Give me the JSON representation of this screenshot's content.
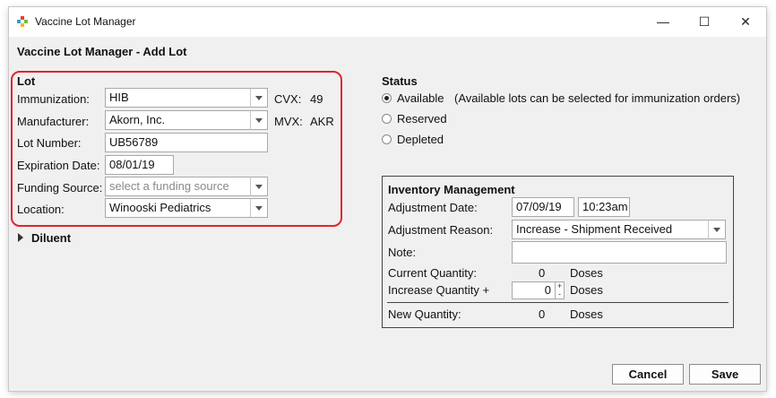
{
  "window": {
    "title": "Vaccine Lot Manager",
    "controls": {
      "minimize": "—",
      "maximize": "☐",
      "close": "✕"
    }
  },
  "page": {
    "heading": "Vaccine Lot Manager - Add Lot"
  },
  "lot": {
    "section_title": "Lot",
    "immunization": {
      "label": "Immunization:",
      "value": "HIB",
      "code_label": "CVX:",
      "code": "49"
    },
    "manufacturer": {
      "label": "Manufacturer:",
      "value": "Akorn, Inc.",
      "code_label": "MVX:",
      "code": "AKR"
    },
    "lot_number": {
      "label": "Lot Number:",
      "value": "UB56789"
    },
    "expiration": {
      "label": "Expiration Date:",
      "value": "08/01/19"
    },
    "funding": {
      "label": "Funding Source:",
      "value": "",
      "placeholder": "select a funding source"
    },
    "location": {
      "label": "Location:",
      "value": "Winooski Pediatrics"
    }
  },
  "diluent": {
    "label": "Diluent"
  },
  "status": {
    "title": "Status",
    "options": [
      {
        "label": "Available",
        "selected": true,
        "note": "(Available lots can be selected for immunization orders)"
      },
      {
        "label": "Reserved",
        "selected": false
      },
      {
        "label": "Depleted",
        "selected": false
      }
    ]
  },
  "inventory": {
    "title": "Inventory Management",
    "adjustment_date": {
      "label": "Adjustment Date:",
      "date": "07/09/19",
      "time": "10:23am"
    },
    "adjustment_reason": {
      "label": "Adjustment Reason:",
      "value": "Increase - Shipment Received"
    },
    "note": {
      "label": "Note:",
      "value": ""
    },
    "current_quantity": {
      "label": "Current Quantity:",
      "value": "0",
      "unit": "Doses"
    },
    "increase_quantity": {
      "label": "Increase Quantity +",
      "value": "0",
      "unit": "Doses",
      "up": "+",
      "down": "-"
    },
    "new_quantity": {
      "label": "New Quantity:",
      "value": "0",
      "unit": "Doses"
    }
  },
  "buttons": {
    "cancel": "Cancel",
    "save": "Save"
  },
  "colors": {
    "highlight": "#e3242b",
    "window_bg": "#f0f0f0"
  }
}
